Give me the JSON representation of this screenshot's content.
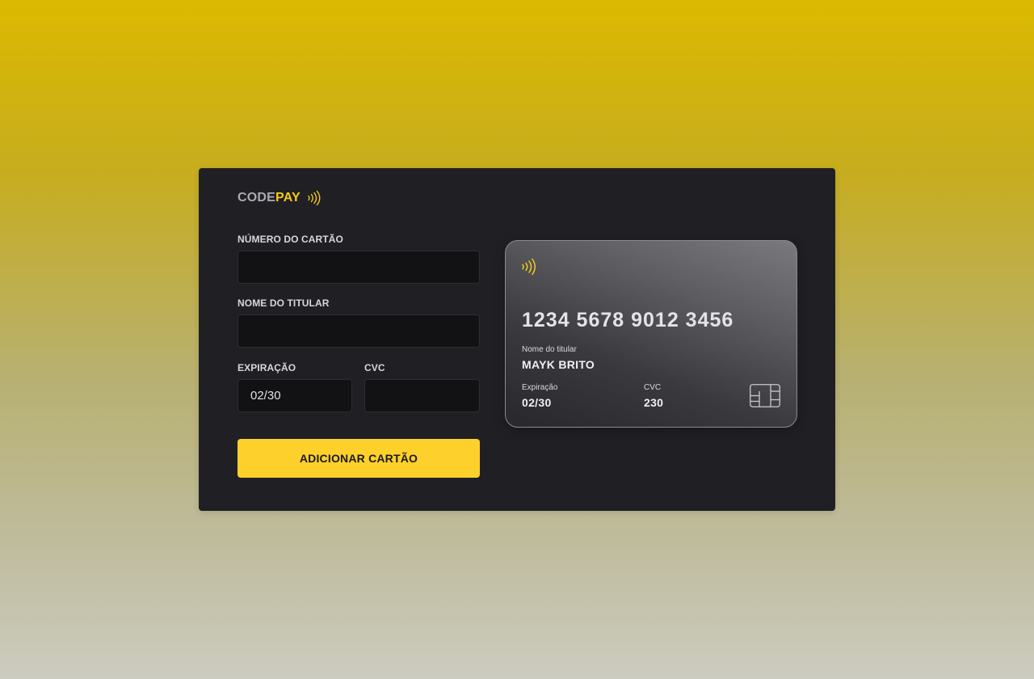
{
  "brand": {
    "code": "CODE",
    "pay": "PAY",
    "icon": "contactless-icon"
  },
  "form": {
    "card_number": {
      "label": "NÚMERO DO CARTÃO",
      "value": "",
      "placeholder": ""
    },
    "holder_name": {
      "label": "NOME DO TITULAR",
      "value": "",
      "placeholder": ""
    },
    "expiration": {
      "label": "EXPIRAÇÃO",
      "value": "02/30",
      "placeholder": ""
    },
    "cvc": {
      "label": "CVC",
      "value": "",
      "placeholder": ""
    },
    "submit_label": "ADICIONAR CARTÃO"
  },
  "card_preview": {
    "number": "1234 5678 9012 3456",
    "holder_label": "Nome do titular",
    "holder_value": "MAYK BRITO",
    "expiration_label": "Expiração",
    "expiration_value": "02/30",
    "cvc_label": "CVC",
    "cvc_value": "230",
    "icons": [
      "contactless-icon",
      "chip-icon"
    ]
  },
  "colors": {
    "accent": "#fdd02b",
    "brand_pay": "#f5c918",
    "panel_bg": "#202024",
    "input_bg": "#121214"
  }
}
